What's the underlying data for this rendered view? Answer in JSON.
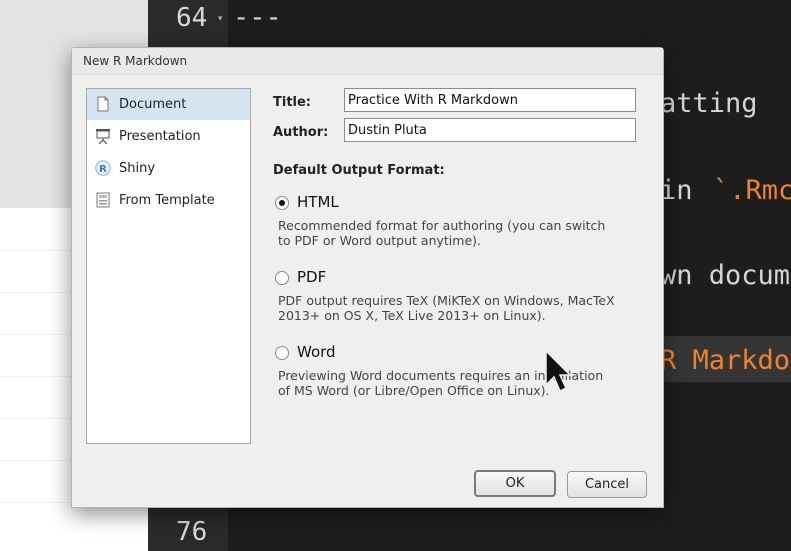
{
  "editor": {
    "line_top": "64",
    "line_bottom": "76",
    "code_lines": [
      {
        "text": "---",
        "orange": false
      },
      {
        "text": "atting",
        "orange": false
      },
      {
        "text": "in ",
        "orange": false
      },
      {
        "text": "`.Rmc",
        "orange": true
      },
      {
        "text": "wn docum",
        "orange": false
      },
      {
        "text": "R Markdo",
        "orange": true
      }
    ]
  },
  "dialog": {
    "title": "New R Markdown",
    "sidebar": [
      {
        "label": "Document",
        "icon": "document-icon",
        "selected": true
      },
      {
        "label": "Presentation",
        "icon": "presentation-icon",
        "selected": false
      },
      {
        "label": "Shiny",
        "icon": "shiny-r-icon",
        "selected": false
      },
      {
        "label": "From Template",
        "icon": "template-icon",
        "selected": false
      }
    ],
    "title_label": "Title:",
    "title_value": "Practice With R Markdown",
    "author_label": "Author:",
    "author_value": "Dustin Pluta",
    "output_heading": "Default Output Format:",
    "formats": [
      {
        "label": "HTML",
        "checked": true,
        "desc": [
          "Recommended format for authoring (you can switch",
          "to PDF or Word output anytime)."
        ]
      },
      {
        "label": "PDF",
        "checked": false,
        "desc": [
          "PDF output requires TeX (MiKTeX on Windows, MacTeX",
          "2013+ on OS X, TeX Live 2013+ on Linux)."
        ]
      },
      {
        "label": "Word",
        "checked": false,
        "desc": [
          "Previewing Word documents requires an installation",
          "of MS Word (or Libre/Open Office on Linux)."
        ]
      }
    ],
    "ok_label": "OK",
    "cancel_label": "Cancel"
  }
}
